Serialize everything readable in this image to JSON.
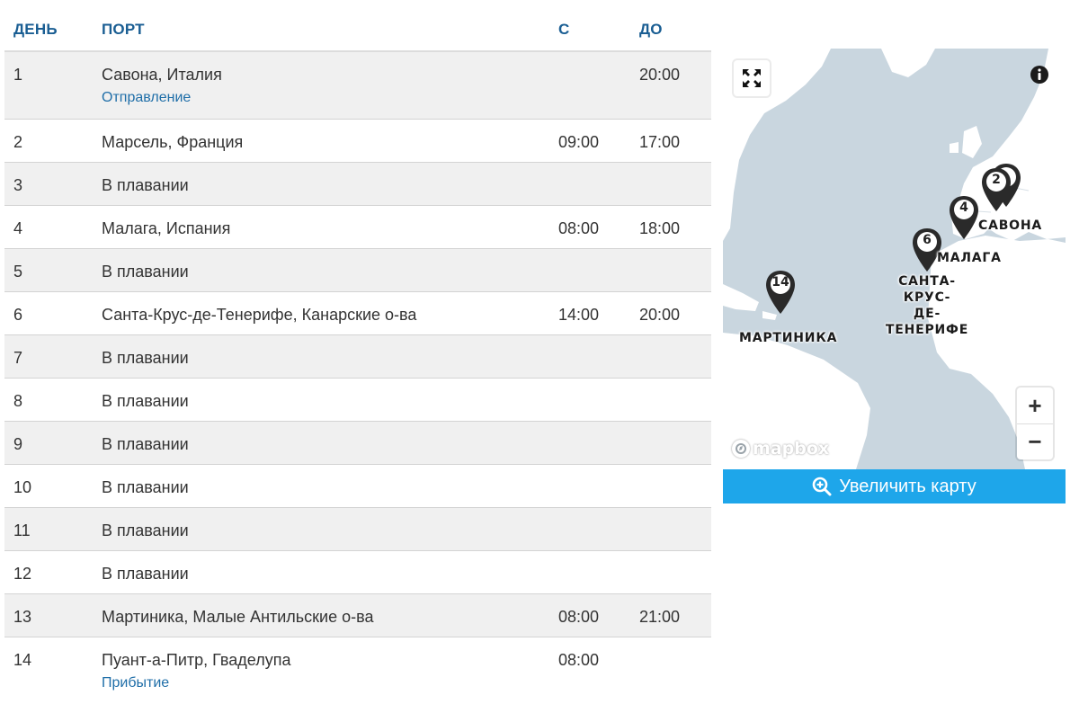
{
  "table": {
    "headers": {
      "day": "ДЕНЬ",
      "port": "ПОРТ",
      "from": "С",
      "to": "ДО"
    },
    "rows": [
      {
        "day": "1",
        "port": "Савона, Италия",
        "from": "",
        "to": "20:00",
        "note": "Отправление"
      },
      {
        "day": "2",
        "port": "Марсель, Франция",
        "from": "09:00",
        "to": "17:00"
      },
      {
        "day": "3",
        "port": "В плавании",
        "from": "",
        "to": ""
      },
      {
        "day": "4",
        "port": "Малага, Испания",
        "from": "08:00",
        "to": "18:00"
      },
      {
        "day": "5",
        "port": "В плавании",
        "from": "",
        "to": ""
      },
      {
        "day": "6",
        "port": "Санта-Крус-де-Тенерифе, Канарские о-ва",
        "from": "14:00",
        "to": "20:00"
      },
      {
        "day": "7",
        "port": "В плавании",
        "from": "",
        "to": ""
      },
      {
        "day": "8",
        "port": "В плавании",
        "from": "",
        "to": ""
      },
      {
        "day": "9",
        "port": "В плавании",
        "from": "",
        "to": ""
      },
      {
        "day": "10",
        "port": "В плавании",
        "from": "",
        "to": ""
      },
      {
        "day": "11",
        "port": "В плавании",
        "from": "",
        "to": ""
      },
      {
        "day": "12",
        "port": "В плавании",
        "from": "",
        "to": ""
      },
      {
        "day": "13",
        "port": "Мартиника, Малые Антильские о-ва",
        "from": "08:00",
        "to": "21:00"
      },
      {
        "day": "14",
        "port": "Пуант-а-Питр, Гваделупа",
        "from": "08:00",
        "to": "",
        "note": "Прибытие"
      }
    ]
  },
  "map": {
    "pins": {
      "p2": "2",
      "p4": "4",
      "p6": "6",
      "p14": "14"
    },
    "labels": {
      "savona": "САВОНА",
      "malaga": "МАЛАГА",
      "tenerife_line1": "САНТА-КРУС-",
      "tenerife_line2": "ДЕ-ТЕНЕРИФЕ",
      "martinique": "МАРТИНИКА"
    },
    "zoom_in": "+",
    "zoom_out": "−",
    "attribution": "mapbox",
    "enlarge_label": "Увеличить карту",
    "icons": [
      "fullscreen-icon",
      "info-icon",
      "magnifier-plus-icon",
      "mapbox-logo-icon",
      "map-pin-icon"
    ],
    "colors": {
      "water": "#c9d6df",
      "land": "#ffffff",
      "header_text": "#1a5e93",
      "link": "#1f6ea8",
      "button": "#1ea6ea"
    }
  }
}
